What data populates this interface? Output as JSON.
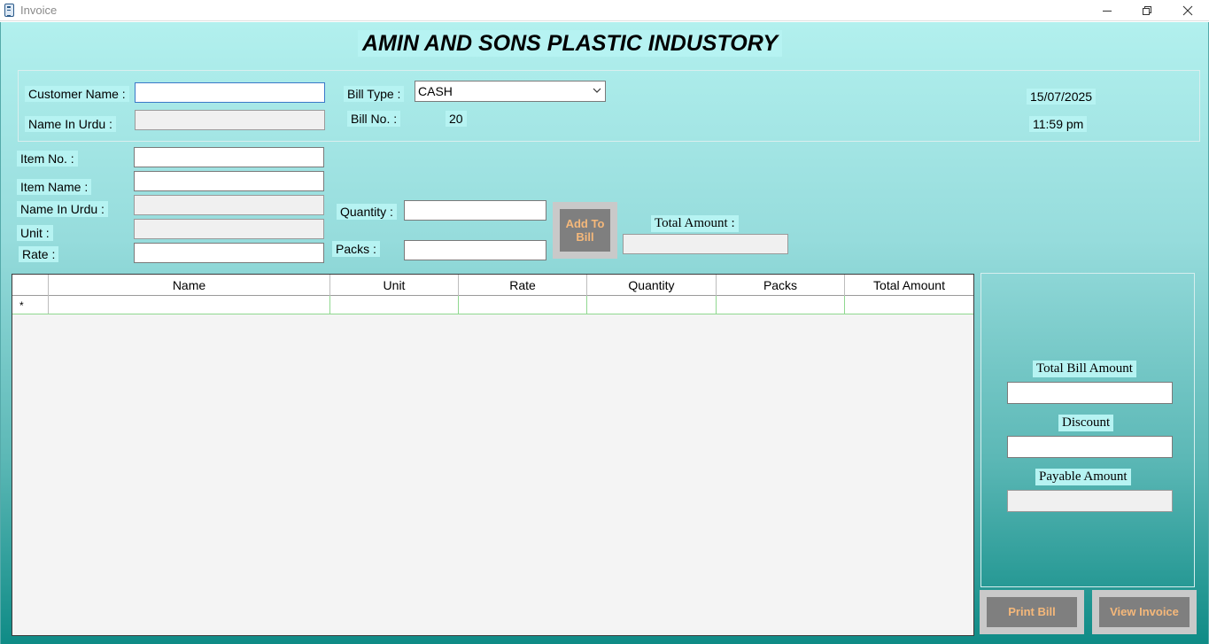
{
  "window": {
    "title": "Invoice"
  },
  "header": {
    "company": "AMIN AND SONS PLASTIC INDUSTORY"
  },
  "customer": {
    "name_label": "Customer Name :",
    "name_value": "",
    "urdu_label": "Name  In Urdu :",
    "urdu_value": "",
    "bill_type_label": "Bill Type :",
    "bill_type_value": "CASH",
    "bill_no_label": "Bill No. :",
    "bill_no_value": "20",
    "date": "15/07/2025",
    "time": "11:59 pm"
  },
  "item": {
    "item_no_label": "Item No. :",
    "item_name_label": "Item Name :",
    "urdu_label": "Name  In Urdu :",
    "unit_label": "Unit :",
    "rate_label": "Rate :",
    "quantity_label": "Quantity :",
    "packs_label": "Packs :",
    "add_button": "Add To Bill",
    "total_amount_label": "Total Amount :"
  },
  "grid": {
    "columns": [
      "Name",
      "Unit",
      "Rate",
      "Quantity",
      "Packs",
      "Total Amount"
    ],
    "new_row_marker": "*"
  },
  "summary": {
    "total_bill_label": "Total Bill Amount",
    "discount_label": "Discount",
    "payable_label": "Payable Amount"
  },
  "actions": {
    "print_bill": "Print Bill",
    "view_invoice": "View Invoice"
  },
  "icons": {
    "app": "invoice-app-icon",
    "minimize": "minimize-icon",
    "restore": "restore-icon",
    "close": "close-icon",
    "dropdown": "chevron-down-icon"
  },
  "colors": {
    "form_gradient_top": "#b2f0ee",
    "form_gradient_bottom": "#0f8b86",
    "label_background": "#b6f3f2",
    "button_face": "#7f7f7f",
    "button_text": "#f5b87a",
    "grid_row_line": "#90d890"
  }
}
